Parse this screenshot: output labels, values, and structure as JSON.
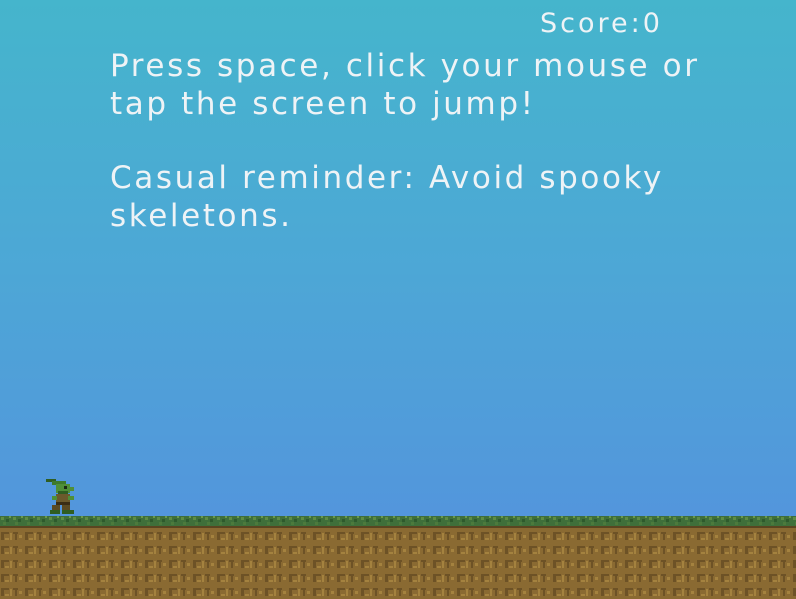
{
  "hud": {
    "score_label": "Score:",
    "score_value": "0"
  },
  "instructions": {
    "line1": "Press space, click your mouse or tap the screen to jump!",
    "line2": "Casual reminder: Avoid spooky skeletons."
  },
  "sprites": {
    "player": "goblin-character-icon",
    "ground": "grass-dirt-tiles"
  },
  "colors": {
    "sky_top": "#45b5cc",
    "sky_bottom": "#5590de",
    "text": "#eef3f6",
    "grass": "#3f6f3a",
    "dirt": "#8a6a32"
  }
}
